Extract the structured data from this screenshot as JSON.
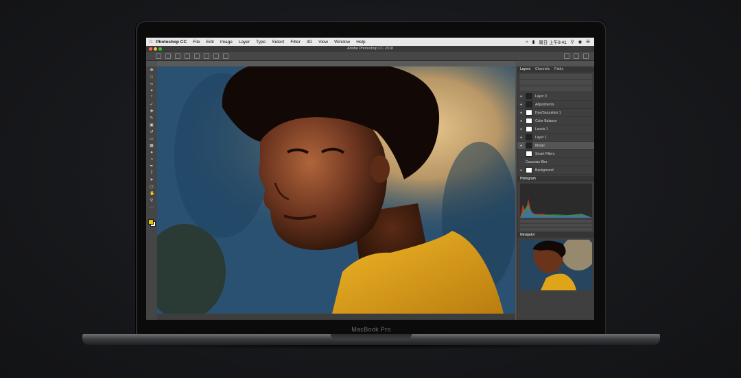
{
  "device": {
    "model_label": "MacBook Pro"
  },
  "menubar": {
    "app_name": "Photoshop CC",
    "items": [
      "File",
      "Edit",
      "Image",
      "Layer",
      "Type",
      "Select",
      "Filter",
      "3D",
      "View",
      "Window",
      "Help"
    ],
    "clock": "周日 上午9:41"
  },
  "window": {
    "title": "Adobe Photoshop CC 2018"
  },
  "panels": {
    "tabs": [
      "Layers",
      "Channels",
      "Paths"
    ],
    "layers": [
      "Layer 0",
      "Adjustments",
      "Hue/Saturation 1",
      "Color Balance",
      "Levels 1",
      "Layer 1",
      "Model",
      "Smart Filters",
      "Gaussian Blur",
      "Background"
    ],
    "histogram_label": "Histogram",
    "navigator_label": "Navigator"
  },
  "colors": {
    "shirt": "#e0a419",
    "background_blue": "#274b66",
    "background_glow": "#d9b980"
  }
}
